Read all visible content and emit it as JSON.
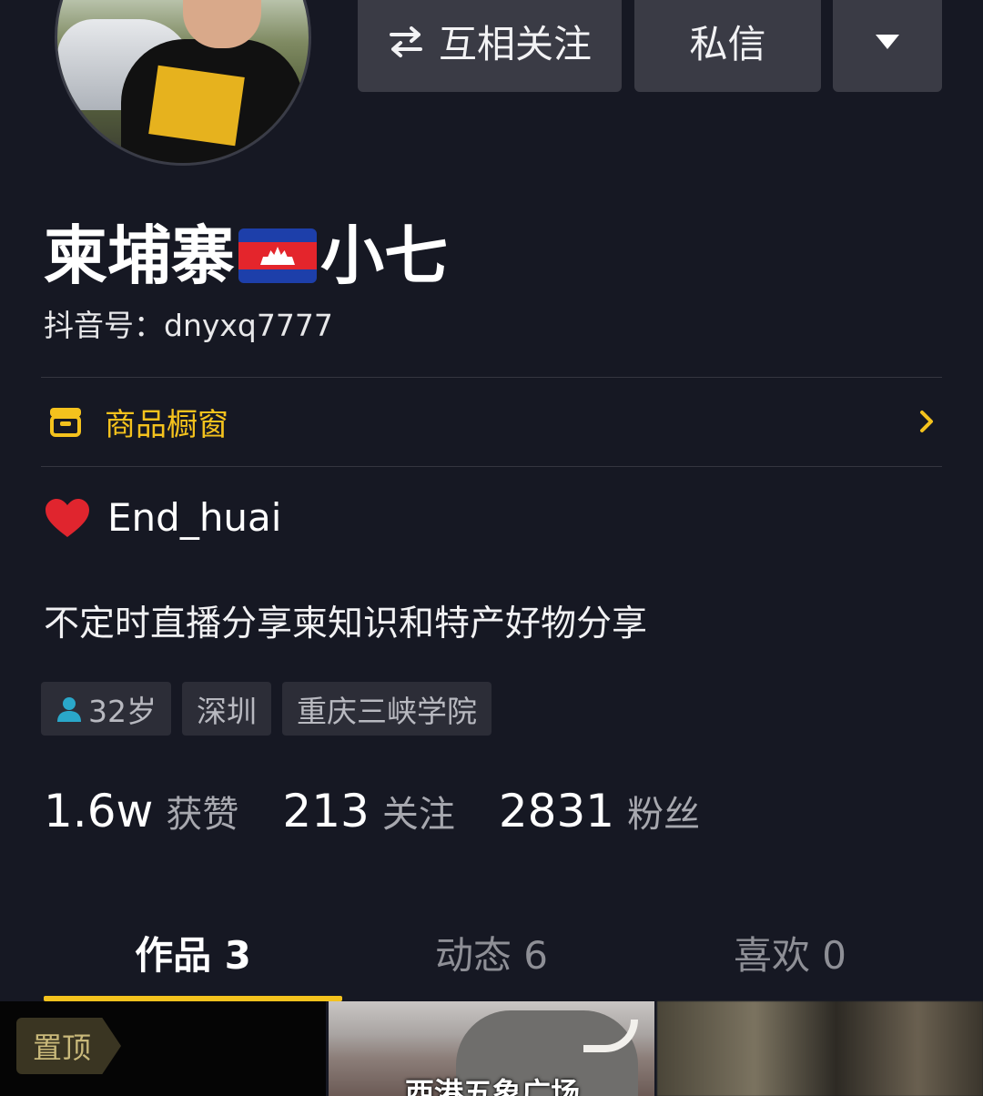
{
  "header": {
    "follow_button": "互相关注",
    "message_button": "私信"
  },
  "profile": {
    "name_part1": "柬埔寨",
    "name_part2": "小七",
    "douyin_id": "抖音号：dnyxq7777",
    "signature": "End_huai",
    "bio": "不定时直播分享柬知识和特产好物分享"
  },
  "shop": {
    "label": "商品橱窗"
  },
  "tags": [
    {
      "label": "32岁"
    },
    {
      "label": "深圳"
    },
    {
      "label": "重庆三峡学院"
    }
  ],
  "stats": {
    "likes_count": "1.6w",
    "likes_label": "获赞",
    "following_count": "213",
    "following_label": "关注",
    "followers_count": "2831",
    "followers_label": "粉丝"
  },
  "tabs": [
    {
      "label": "作品 3",
      "active": true
    },
    {
      "label": "动态 6",
      "active": false
    },
    {
      "label": "喜欢 0",
      "active": false
    }
  ],
  "videos": [
    {
      "badge": "置顶",
      "caption": ""
    },
    {
      "badge": "",
      "caption": "西港五象广场"
    },
    {
      "badge": "",
      "caption": ""
    }
  ],
  "colors": {
    "background": "#161823",
    "accent_yellow": "#f4c21d",
    "button_bg": "#3a3b45"
  },
  "icons": [
    "swap-icon",
    "chevron-down-icon",
    "cambodia-flag-icon",
    "shop-icon",
    "chevron-right-icon",
    "heart-icon",
    "person-icon"
  ]
}
